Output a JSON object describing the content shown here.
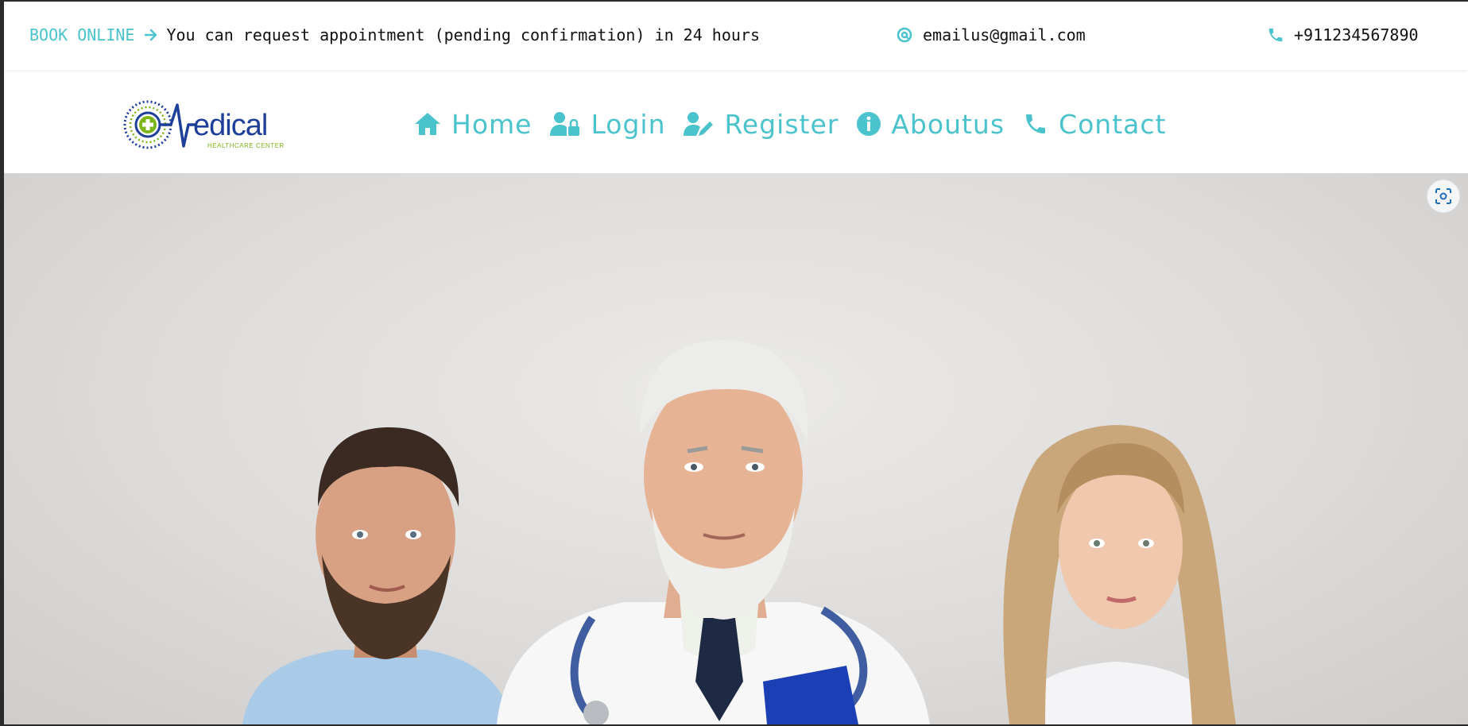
{
  "topbar": {
    "book_label": "BOOK ONLINE",
    "book_text": "You can request appointment (pending confirmation) in 24 hours",
    "email": "emailus@gmail.com",
    "phone": "+911234567890"
  },
  "logo": {
    "wordmark": "Medical",
    "tagline": "HEALTHCARE CENTER",
    "binary": "0101010101010"
  },
  "nav": {
    "items": [
      {
        "label": "Home",
        "icon": "home-icon"
      },
      {
        "label": "Login",
        "icon": "user-lock-icon"
      },
      {
        "label": "Register",
        "icon": "user-edit-icon"
      },
      {
        "label": "Aboutus",
        "icon": "info-circle-icon"
      },
      {
        "label": "Contact",
        "icon": "phone-icon"
      }
    ]
  },
  "colors": {
    "accent": "#4bc3cc",
    "logo_blue": "#1d3f9a",
    "logo_green": "#7cb518"
  }
}
